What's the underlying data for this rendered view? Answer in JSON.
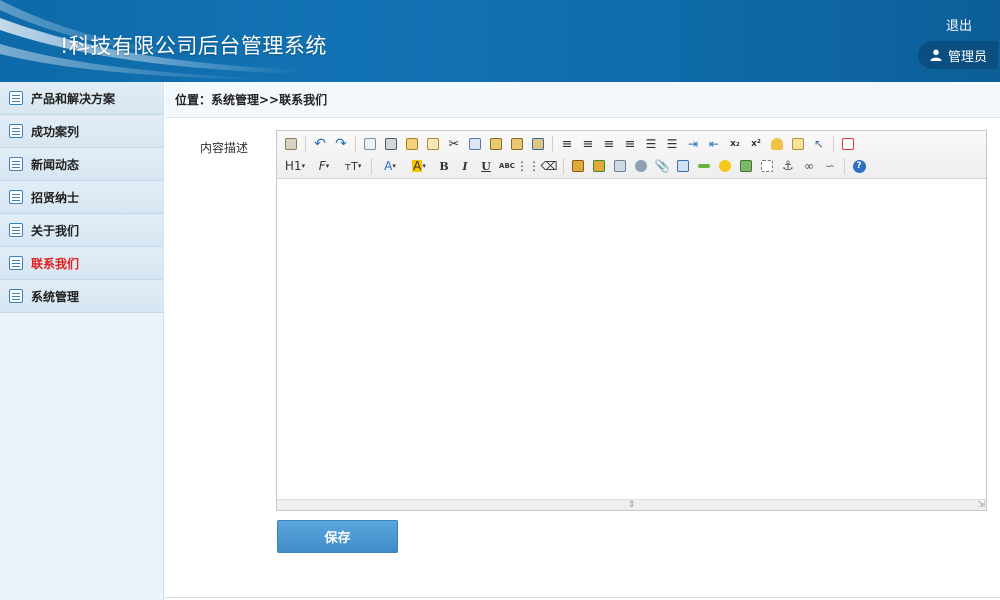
{
  "header": {
    "title": "!科技有限公司后台管理系统",
    "logout_label": "退出",
    "user_label": "管理员",
    "user_icon": "user-icon",
    "bg_color": "#1273b4"
  },
  "sidebar": {
    "items": [
      {
        "label": "产品和解决方案",
        "icon": "list-icon",
        "active": false
      },
      {
        "label": "成功案列",
        "icon": "list-icon",
        "active": false
      },
      {
        "label": "新闻动态",
        "icon": "list-icon",
        "active": false
      },
      {
        "label": "招贤纳士",
        "icon": "list-icon",
        "active": false
      },
      {
        "label": "关于我们",
        "icon": "list-icon",
        "active": false
      },
      {
        "label": "联系我们",
        "icon": "list-icon",
        "active": true
      },
      {
        "label": "系统管理",
        "icon": "list-icon",
        "active": false
      }
    ],
    "active_color": "#e02020"
  },
  "breadcrumb": {
    "text": "位置：系统管理>>联系我们"
  },
  "form": {
    "content_label": "内容描述",
    "editor_value": ""
  },
  "toolbar": {
    "heading_label": "H1",
    "font_family_label": "F",
    "font_size_label": "T",
    "font_color_label": "A",
    "bg_color_label": "A",
    "bold_label": "B",
    "italic_label": "I",
    "underline_label": "U",
    "strike_label": "ABC"
  },
  "actions": {
    "save_label": "保存",
    "save_color": "#4a99d3"
  }
}
